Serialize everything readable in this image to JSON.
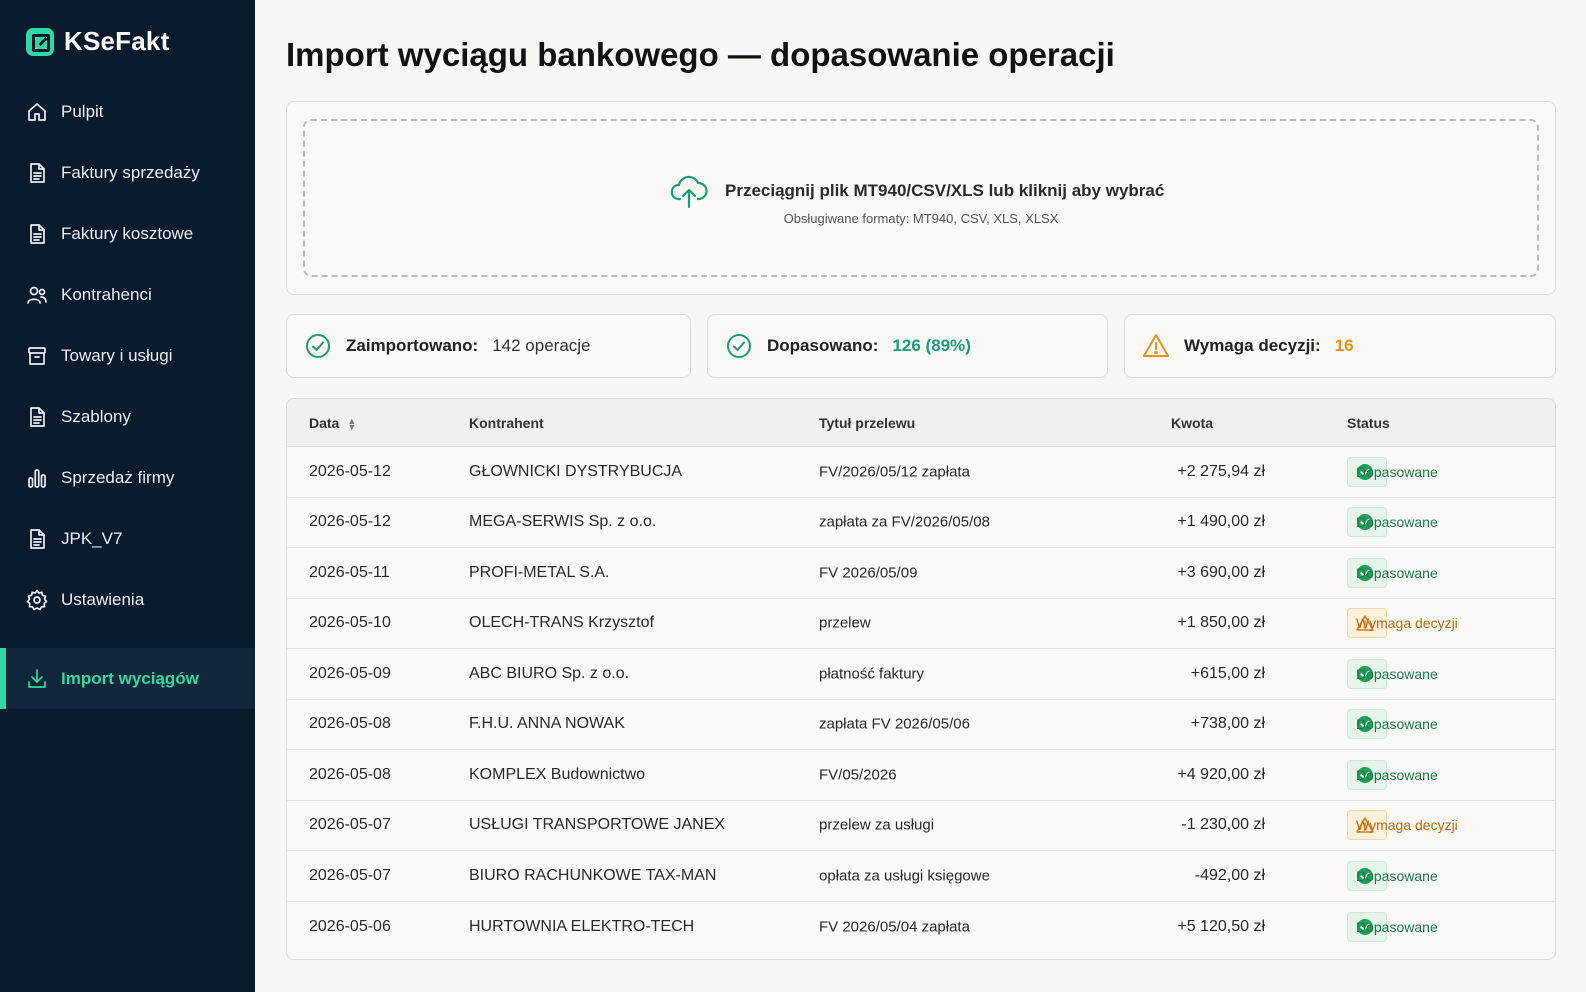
{
  "app": {
    "name": "KSeFakt"
  },
  "sidebar": {
    "items": [
      {
        "label": "Pulpit",
        "icon": "home-icon"
      },
      {
        "label": "Faktury sprzedaży",
        "icon": "document-icon"
      },
      {
        "label": "Faktury kosztowe",
        "icon": "document-icon"
      },
      {
        "label": "Kontrahenci",
        "icon": "users-icon"
      },
      {
        "label": "Towary i usługi",
        "icon": "box-icon"
      },
      {
        "label": "Szablony",
        "icon": "document-icon"
      },
      {
        "label": "Sprzedaż firmy",
        "icon": "bar-chart-icon"
      },
      {
        "label": "JPK_V7",
        "icon": "document-icon"
      },
      {
        "label": "Ustawienia",
        "icon": "gear-icon"
      },
      {
        "label": "Import wyciągów",
        "icon": "download-icon",
        "active": true
      }
    ]
  },
  "page": {
    "title": "Import wyciągu bankowego — dopasowanie operacji"
  },
  "dropzone": {
    "text": "Przeciągnij plik MT940/CSV/XLS  lub kliknij aby wybrać",
    "formats": "Obsługiwane formaty: MT940, CSV, XLS, XLSX"
  },
  "stats": {
    "imported": {
      "label": "Zaimportowano:",
      "value": "142 operacje"
    },
    "matched": {
      "label": "Dopasowano:",
      "value": "126 (89%)"
    },
    "pending": {
      "label": "Wymaga decyzji:",
      "value": "16"
    }
  },
  "colors": {
    "accent": "#2fd8a4",
    "sidebar": "#0c1a2e",
    "ok": "#1a9e78",
    "warn": "#e8911a"
  },
  "table": {
    "headers": {
      "date": "Data",
      "contractor": "Kontrahent",
      "title": "Tytuł przelewu",
      "amount": "Kwota",
      "status": "Status"
    },
    "rows": [
      {
        "date": "2026-05-12",
        "contractor": "GŁOWNICKI DYSTRYBUCJA",
        "title": "FV/2026/05/12 zapłata",
        "amount": "+2 275,94 zł",
        "status": "Dopasowane",
        "kind": "ok"
      },
      {
        "date": "2026-05-12",
        "contractor": "MEGA-SERWIS Sp. z o.o.",
        "title": "zapłata za FV/2026/05/08",
        "amount": "+1 490,00 zł",
        "status": "Dopasowane",
        "kind": "ok"
      },
      {
        "date": "2026-05-11",
        "contractor": "PROFI-METAL S.A.",
        "title": "FV 2026/05/09",
        "amount": "+3 690,00 zł",
        "status": "Dopasowane",
        "kind": "ok"
      },
      {
        "date": "2026-05-10",
        "contractor": "OLECH-TRANS Krzysztof",
        "title": "przelew",
        "amount": "+1 850,00 zł",
        "status": "Wymaga decyzji",
        "kind": "warn"
      },
      {
        "date": "2026-05-09",
        "contractor": "ABC BIURO Sp. z o.o.",
        "title": "płatność faktury",
        "amount": "+615,00 zł",
        "status": "Dopasowane",
        "kind": "ok"
      },
      {
        "date": "2026-05-08",
        "contractor": "F.H.U. ANNA NOWAK",
        "title": "zapłata FV 2026/05/06",
        "amount": "+738,00 zł",
        "status": "Dopasowane",
        "kind": "ok"
      },
      {
        "date": "2026-05-08",
        "contractor": "KOMPLEX Budownictwo",
        "title": "FV/05/2026",
        "amount": "+4 920,00 zł",
        "status": "Dopasowane",
        "kind": "ok"
      },
      {
        "date": "2026-05-07",
        "contractor": "USŁUGI TRANSPORTOWE JANEX",
        "title": "przelew za usługi",
        "amount": "-1 230,00 zł",
        "status": "Wymaga decyzji",
        "kind": "warn"
      },
      {
        "date": "2026-05-07",
        "contractor": "BIURO RACHUNKOWE TAX-MAN",
        "title": "opłata za usługi księgowe",
        "amount": "-492,00 zł",
        "status": "Dopasowane",
        "kind": "ok"
      },
      {
        "date": "2026-05-06",
        "contractor": "HURTOWNIA ELEKTRO-TECH",
        "title": "FV 2026/05/04 zapłata",
        "amount": "+5 120,50 zł",
        "status": "Dopasowane",
        "kind": "ok"
      }
    ]
  }
}
